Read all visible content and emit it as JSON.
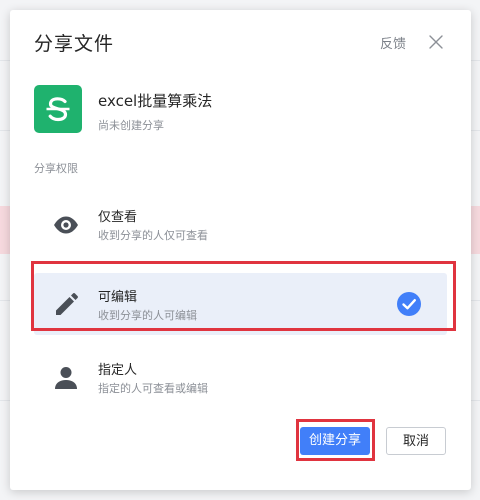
{
  "dialog": {
    "title": "分享文件",
    "feedback_label": "反馈"
  },
  "file": {
    "name": "excel批量算乘法",
    "status": "尚未创建分享"
  },
  "share": {
    "section_label": "分享权限",
    "options": [
      {
        "title": "仅查看",
        "desc": "收到分享的人仅可查看",
        "icon": "eye-icon",
        "selected": false
      },
      {
        "title": "可编辑",
        "desc": "收到分享的人可编辑",
        "icon": "pencil-icon",
        "selected": true
      },
      {
        "title": "指定人",
        "desc": "指定的人可查看或编辑",
        "icon": "person-icon",
        "selected": false
      }
    ]
  },
  "buttons": {
    "create_label": "创建分享",
    "cancel_label": "取消"
  },
  "colors": {
    "accent": "#417ff9",
    "file_icon_bg": "#1fb26e",
    "highlight": "#e0343f",
    "selected_bg": "#eaeff9"
  }
}
